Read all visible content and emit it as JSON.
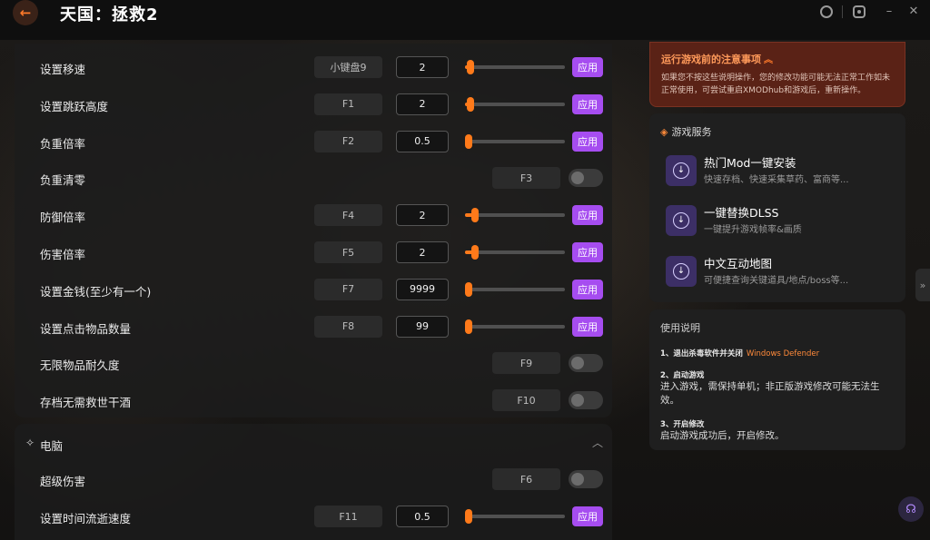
{
  "app": {
    "title": "天国：拯救2",
    "back_icon": "←"
  },
  "window_controls": {
    "avatar_icon": "user-icon",
    "settings_icon": "settings-icon",
    "minimize_label": "–",
    "close_label": "✕"
  },
  "settings": [
    {
      "label": "设置移速",
      "hotkey": "小键盘9",
      "value": "2",
      "slider": 0.05,
      "apply": "应用",
      "type": "slider"
    },
    {
      "label": "设置跳跃高度",
      "hotkey": "F1",
      "value": "2",
      "slider": 0.05,
      "apply": "应用",
      "type": "slider"
    },
    {
      "label": "负重倍率",
      "hotkey": "F2",
      "value": "0.5",
      "slider": 0.0,
      "apply": "应用",
      "type": "slider"
    },
    {
      "label": "负重清零",
      "hotkey": "F3",
      "type": "toggle",
      "on": false
    },
    {
      "label": "防御倍率",
      "hotkey": "F4",
      "value": "2",
      "slider": 0.1,
      "apply": "应用",
      "type": "slider"
    },
    {
      "label": "伤害倍率",
      "hotkey": "F5",
      "value": "2",
      "slider": 0.1,
      "apply": "应用",
      "type": "slider"
    },
    {
      "label": "设置金钱(至少有一个)",
      "hotkey": "F7",
      "value": "9999",
      "slider": 0.0,
      "apply": "应用",
      "type": "slider"
    },
    {
      "label": "设置点击物品数量",
      "hotkey": "F8",
      "value": "99",
      "slider": 0.0,
      "apply": "应用",
      "type": "slider"
    },
    {
      "label": "无限物品耐久度",
      "hotkey": "F9",
      "type": "toggle",
      "on": false
    },
    {
      "label": "存档无需救世干酒",
      "hotkey": "F10",
      "type": "toggle",
      "on": false
    }
  ],
  "section_pc": {
    "title": "电脑",
    "icon": "wand-icon",
    "items": [
      {
        "label": "超级伤害",
        "hotkey": "F6",
        "type": "toggle",
        "on": false
      },
      {
        "label": "设置时间流逝速度",
        "hotkey": "F11",
        "value": "0.5",
        "slider": 0.0,
        "apply": "应用",
        "type": "slider"
      }
    ]
  },
  "notice": {
    "title": "运行游戏前的注意事项",
    "body": "如果您不按这些说明操作，您的修改功能可能无法正常工作如未正常使用，可尝试重启XMODhub和游戏后，重新操作。"
  },
  "services": {
    "title": "游戏服务",
    "items": [
      {
        "title": "热门Mod一键安装",
        "desc": "快速存档、快速采集草药、富商等..."
      },
      {
        "title": "一键替换DLSS",
        "desc": "一键提升游戏帧率&画质"
      },
      {
        "title": "中文互动地图",
        "desc": "可便捷查询关键道具/地点/boss等..."
      }
    ]
  },
  "usage": {
    "title": "使用说明",
    "step1_title": "1、退出杀毒软件并关闭",
    "step1_highlight": "Windows Defender",
    "step2_title": "2、启动游戏",
    "step2_body": "进入游戏，需保持单机；非正版游戏修改可能无法生效。",
    "step3_title": "3、开启修改",
    "step3_body": "启动游戏成功后，开启修改。"
  },
  "colors": {
    "accent": "#ff7a1a",
    "apply": "#a64df0",
    "notice_bg": "#5a2216"
  }
}
